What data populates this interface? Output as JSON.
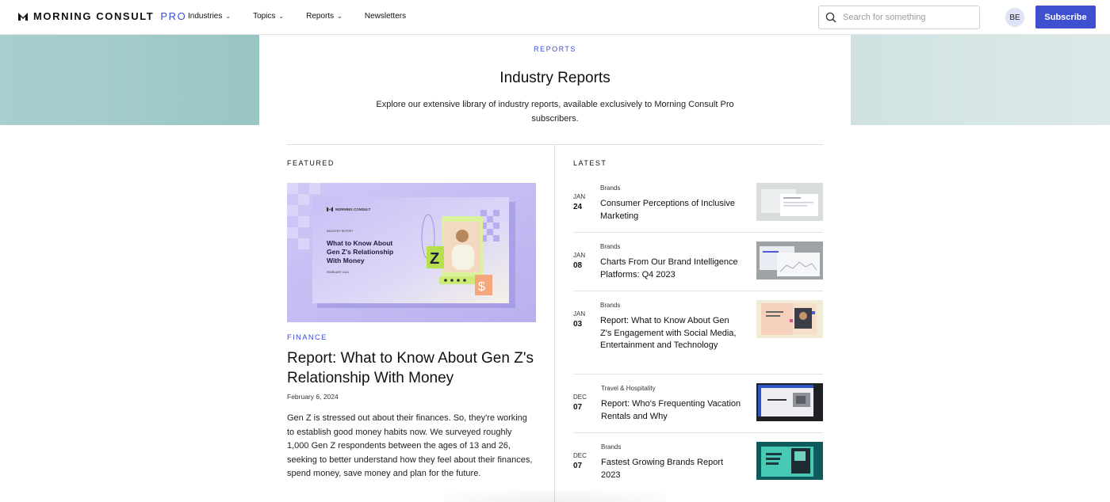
{
  "brand": {
    "name": "MORNING CONSULT",
    "suffix": "PRO",
    "accent": "#3e50d0"
  },
  "nav": {
    "items": [
      {
        "label": "Industries",
        "dropdown": true
      },
      {
        "label": "Topics",
        "dropdown": true
      },
      {
        "label": "Reports",
        "dropdown": true
      },
      {
        "label": "Newsletters",
        "dropdown": false
      }
    ],
    "search_placeholder": "Search for something",
    "avatar_initials": "BE",
    "subscribe_label": "Subscribe"
  },
  "hero": {
    "eyebrow": "REPORTS",
    "title": "Industry Reports",
    "description": "Explore our extensive library of industry reports, available exclusively to Morning Consult Pro subscribers."
  },
  "featured": {
    "section_label": "FEATURED",
    "category": "FINANCE",
    "title": "Report: What to Know About Gen Z's Relationship With Money",
    "date": "February 6, 2024",
    "body": "Gen Z is stressed out about their finances. So, they're working to establish good money habits now. We surveyed roughly 1,000 Gen Z respondents between the ages of 13 and 26, seeking to better understand how they feel about their finances, spend money, save money and plan for the future.",
    "image": {
      "brand": "MORNING CONSULT",
      "kicker": "INDUSTRY REPORT",
      "title": "What to Know About Gen Z's Relationship With Money",
      "date": "FEBRUARY 2024"
    }
  },
  "latest": {
    "section_label": "LATEST",
    "items": [
      {
        "month": "JAN",
        "day": "24",
        "category": "Brands",
        "title": "Consumer Perceptions of Inclusive Marketing",
        "thumb": "gray"
      },
      {
        "month": "JAN",
        "day": "08",
        "category": "Brands",
        "title": "Charts From Our Brand Intelligence Platforms: Q4 2023",
        "thumb": "gray-dark"
      },
      {
        "month": "JAN",
        "day": "03",
        "category": "Brands",
        "title": "Report: What to Know About Gen Z's Engagement with Social Media, Entertainment and Technology",
        "thumb": "peach"
      },
      {
        "month": "DEC",
        "day": "07",
        "category": "Travel & Hospitality",
        "title": "Report: Who's Frequenting Vacation Rentals and Why",
        "thumb": "blue"
      },
      {
        "month": "DEC",
        "day": "07",
        "category": "Brands",
        "title": "Fastest Growing Brands Report 2023",
        "thumb": "teal"
      }
    ]
  }
}
